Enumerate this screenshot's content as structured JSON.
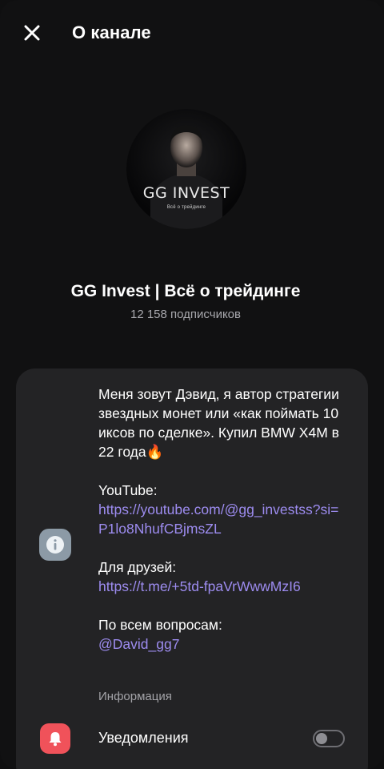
{
  "header": {
    "title": "О канале",
    "close_icon": "close-icon"
  },
  "channel": {
    "avatar_brand": "GG INVEST",
    "avatar_sub": "Всё о трейдинге",
    "name": "GG Invest | Всё о трейдинге",
    "subscribers": "12 158 подписчиков"
  },
  "info": {
    "icon": "info-icon",
    "bio": "Меня зовут Дэвид, я автор стратегии звездных монет или «как поймать 10 иксов по сделке». Купил BMW X4M в 22 года🔥",
    "youtube_label": "YouTube:",
    "youtube_link": "https://youtube.com/@gg_investss?si=P1lo8NhufCBjmsZL",
    "friends_label": "Для друзей:",
    "friends_link": "https://t.me/+5td-fpaVrWwwMzI6",
    "questions_label": "По всем вопросам:",
    "questions_link": "@David_gg7",
    "caption": "Информация"
  },
  "notifications": {
    "icon": "bell-icon",
    "label": "Уведомления",
    "enabled": false
  },
  "colors": {
    "background": "#111112",
    "card": "#232325",
    "link": "#9d8cf0",
    "info_icon_bg": "#8c9aa6",
    "bell_icon_bg": "#f0525a"
  }
}
